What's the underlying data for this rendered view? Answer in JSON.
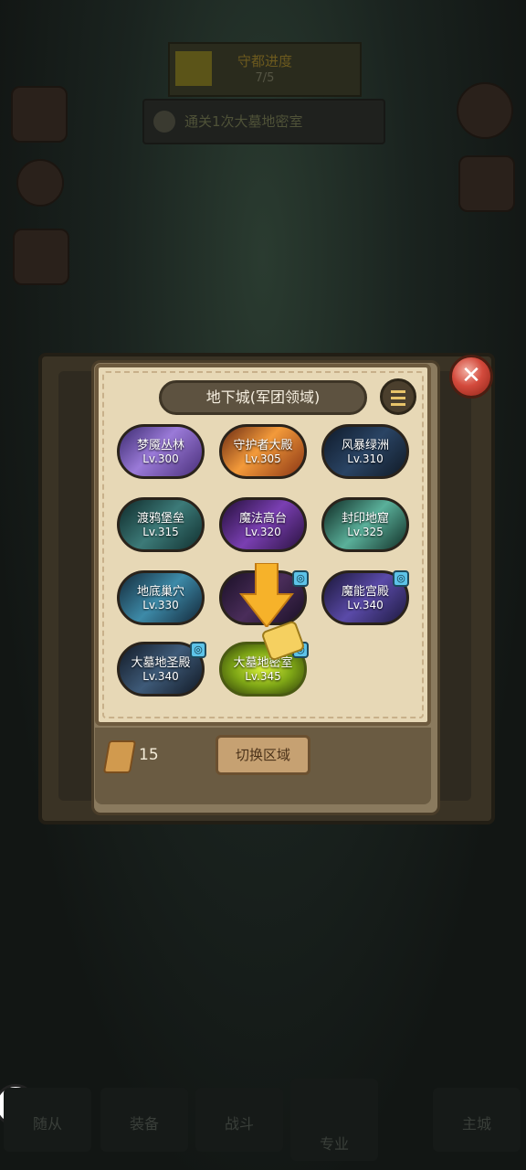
{
  "background": {
    "quest_title": "守都进度",
    "quest_progress": "7/5",
    "task_text": "通关1次大墓地密室"
  },
  "dialog": {
    "title": "地下城(军团领域)",
    "close_icon": "close-icon",
    "menu_icon": "menu-icon"
  },
  "dungeons": [
    {
      "name": "梦魇丛林",
      "level": "Lv.300"
    },
    {
      "name": "守护者大殿",
      "level": "Lv.305"
    },
    {
      "name": "风暴绿洲",
      "level": "Lv.310"
    },
    {
      "name": "渡鸦堡垒",
      "level": "Lv.315"
    },
    {
      "name": "魔法高台",
      "level": "Lv.320"
    },
    {
      "name": "封印地窟",
      "level": "Lv.325"
    },
    {
      "name": "地底巢穴",
      "level": "Lv.330"
    },
    {
      "name": "",
      "level": ""
    },
    {
      "name": "魔能宫殿",
      "level": "Lv.340"
    },
    {
      "name": "大墓地圣殿",
      "level": "Lv.340"
    },
    {
      "name": "大墓地密室",
      "level": "Lv.345"
    }
  ],
  "footer": {
    "scroll_count": "15",
    "switch_label": "切换区域"
  },
  "nav": {
    "items": [
      "随从",
      "装备",
      "战斗",
      "专业",
      "主城"
    ]
  },
  "colors": {
    "parchment": "#e7d8b6",
    "close_red": "#d34a3c",
    "highlight_green": "#a6d41a",
    "guide_yellow": "#f6b22a"
  }
}
